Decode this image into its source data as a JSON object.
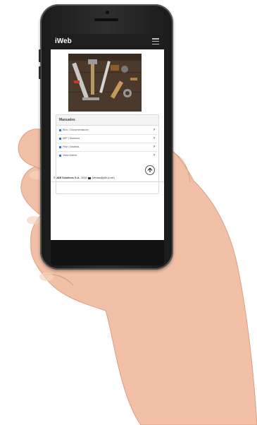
{
  "app": {
    "brand": "iWeb",
    "menu_icon": "hamburger-icon"
  },
  "panel": {
    "title": "Manuales",
    "items": [
      {
        "label": "Bloc | Documentación",
        "chevron": "›"
      },
      {
        "label": "MIP | Modelos",
        "chevron": "›"
      },
      {
        "label": "Plan | Análisis",
        "chevron": "›"
      },
      {
        "label": "Vista Admin.",
        "chevron": "›"
      }
    ]
  },
  "footer": {
    "company": "© J&B Solutions S.A.",
    "year": ", 2019",
    "email": "(ventas@ji&b-ji.net)"
  },
  "colors": {
    "navbar": "#1e1e1e",
    "accent": "#2f78c9"
  }
}
